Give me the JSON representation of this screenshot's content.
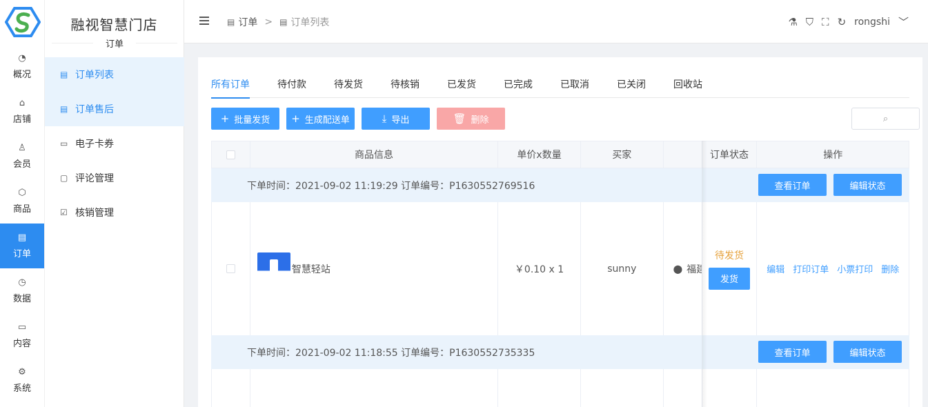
{
  "brand": {
    "name": "融视智慧门店",
    "section": "订单"
  },
  "rail": [
    {
      "icon": "◔",
      "label": "概况"
    },
    {
      "icon": "⌂",
      "label": "店铺"
    },
    {
      "icon": "♙",
      "label": "会员"
    },
    {
      "icon": "⬡",
      "label": "商品"
    },
    {
      "icon": "▤",
      "label": "订单",
      "active": true
    },
    {
      "icon": "◷",
      "label": "数据"
    },
    {
      "icon": "▭",
      "label": "内容"
    },
    {
      "icon": "⚙",
      "label": "系统"
    }
  ],
  "side_menu": [
    {
      "icon": "▤",
      "label": "订单列表"
    },
    {
      "icon": "▤",
      "label": "订单售后"
    },
    {
      "icon": "▭",
      "label": "电子卡券"
    },
    {
      "icon": "▢",
      "label": "评论管理"
    },
    {
      "icon": "☑",
      "label": "核销管理"
    }
  ],
  "breadcrumb": {
    "first": "订单",
    "separator": ">",
    "second": "订单列表"
  },
  "header": {
    "username": "rongshi",
    "caret": "﹀"
  },
  "tabs": [
    "所有订单",
    "待付款",
    "待发货",
    "待核销",
    "已发货",
    "已完成",
    "已取消",
    "已关闭",
    "回收站"
  ],
  "actions": {
    "batch_ship": "批量发货",
    "gen_delivery": "生成配送单",
    "export": "导出",
    "delete": "删除"
  },
  "table": {
    "headers": [
      "商品信息",
      "单价x数量",
      "买家",
      "订单状态",
      "操作"
    ],
    "orders": [
      {
        "info": "下单时间：2021-09-02 11:19:29    订单编号：P1630552769516",
        "view": "查看订单",
        "edit_status": "编辑状态",
        "product": "智慧轻站",
        "price_qty": "￥0.10 x 1",
        "buyer": "sunny",
        "location": "福建",
        "status": "待发货",
        "ship": "发货",
        "ops": [
          "编辑",
          "打印订单",
          "小票打印",
          "删除"
        ]
      },
      {
        "info": "下单时间：2021-09-02 11:18:55    订单编号：P1630552735335",
        "view": "查看订单",
        "edit_status": "编辑状态"
      }
    ]
  },
  "colors": {
    "accent": "#409eff",
    "danger_light": "#f9a7a7",
    "status_pending": "#e6a23c"
  }
}
